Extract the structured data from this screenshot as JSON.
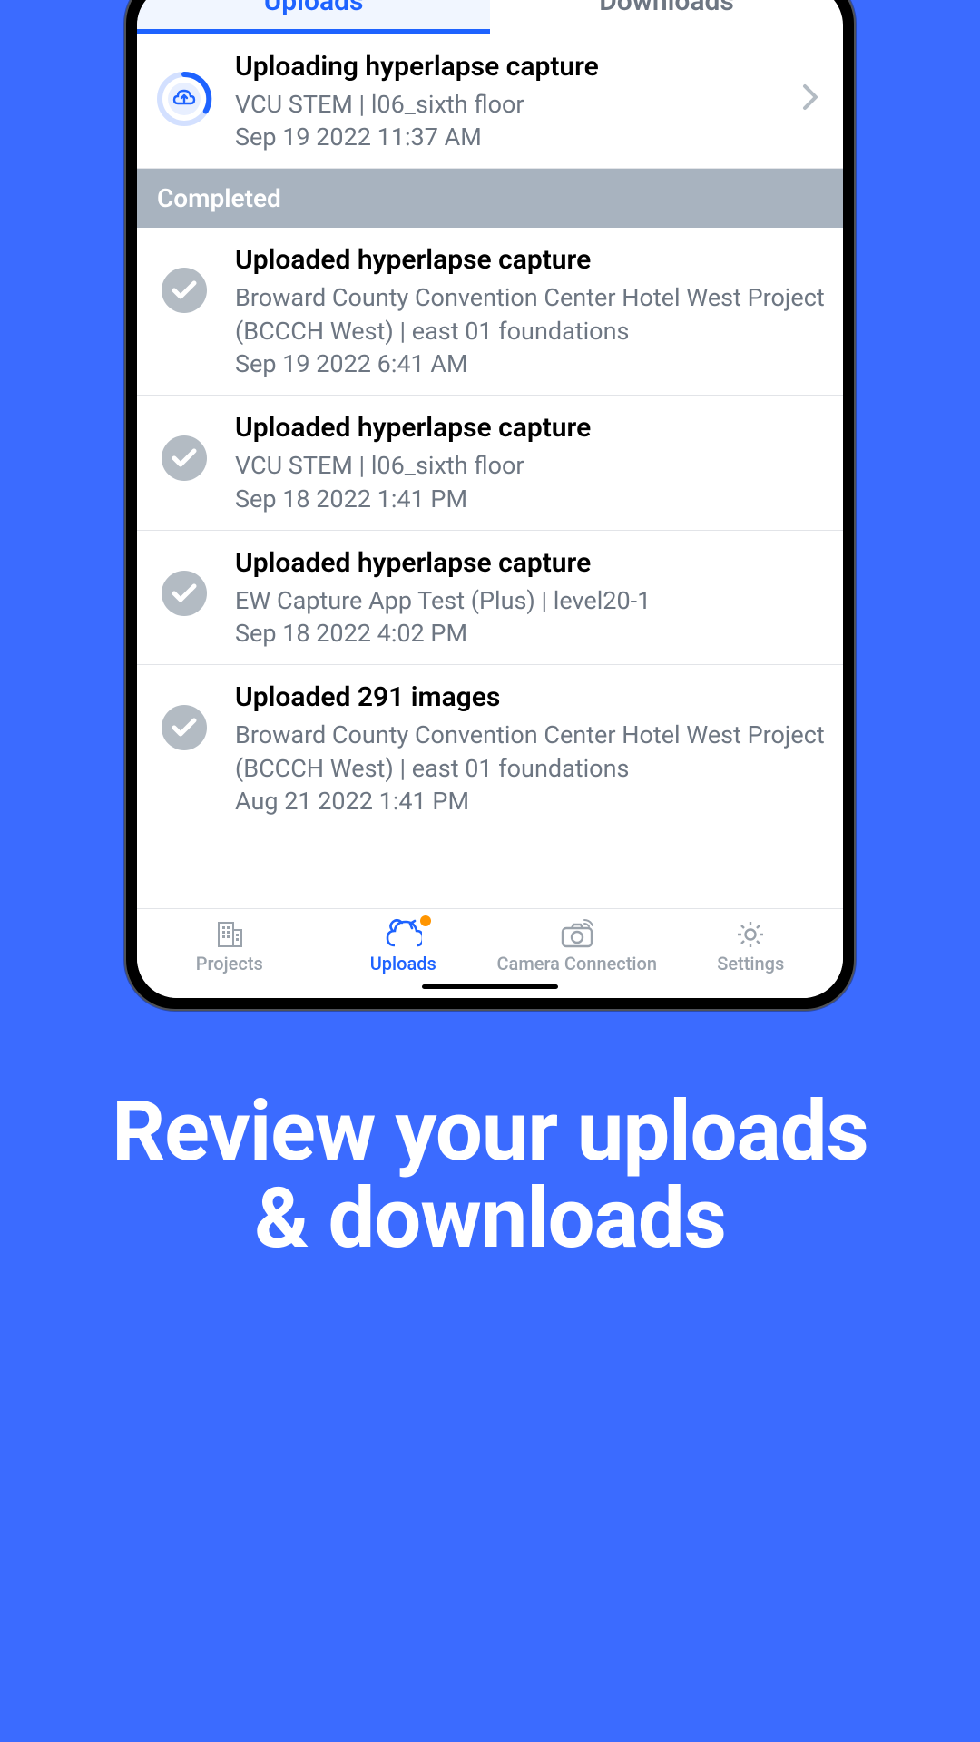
{
  "tabs": {
    "uploads": "Uploads",
    "downloads": "Downloads"
  },
  "active": {
    "title": "Uploading hyperlapse capture",
    "sub": "VCU STEM  |  l06_sixth floor",
    "date": "Sep 19 2022 11:37 AM"
  },
  "completed_label": "Completed",
  "completed": [
    {
      "title": "Uploaded hyperlapse capture",
      "sub": "Broward County Convention Center Hotel West Project (BCCCH West)  |  east 01 foundations",
      "date": "Sep 19 2022 6:41 AM"
    },
    {
      "title": "Uploaded hyperlapse capture",
      "sub": "VCU STEM  |  l06_sixth floor",
      "date": "Sep 18 2022 1:41 PM"
    },
    {
      "title": "Uploaded hyperlapse capture",
      "sub": "EW Capture App Test (Plus)  |  level20-1",
      "date": "Sep 18 2022 4:02 PM"
    },
    {
      "title": "Uploaded 291 images",
      "sub": "Broward County Convention Center Hotel West Project (BCCCH West)  |  east 01 foundations",
      "date": "Aug 21 2022 1:41 PM"
    }
  ],
  "bottom": {
    "projects": "Projects",
    "uploads": "Uploads",
    "camera": "Camera Connection",
    "settings": "Settings"
  },
  "headline_line1": "Review your uploads",
  "headline_line2": "& downloads",
  "colors": {
    "accent": "#1e63ff"
  }
}
